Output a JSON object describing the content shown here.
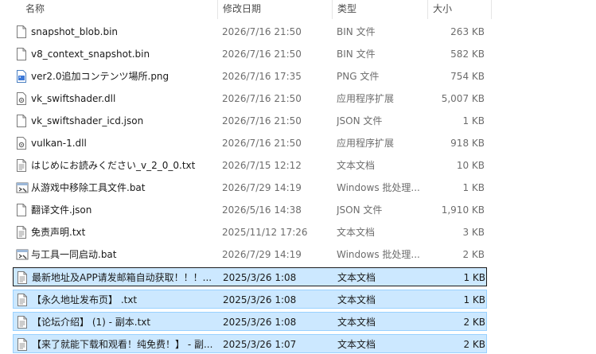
{
  "columns": {
    "name": "名称",
    "date": "修改日期",
    "type": "类型",
    "size": "大小"
  },
  "files": [
    {
      "name": "snapshot_blob.bin",
      "date": "2026/7/16 21:50",
      "type": "BIN 文件",
      "size": "263 KB",
      "icon": "blank-file-icon",
      "selected": false
    },
    {
      "name": "v8_context_snapshot.bin",
      "date": "2026/7/16 21:50",
      "type": "BIN 文件",
      "size": "582 KB",
      "icon": "blank-file-icon",
      "selected": false
    },
    {
      "name": "ver2.0追加コンテンツ場所.png",
      "date": "2026/7/16 17:35",
      "type": "PNG 文件",
      "size": "754 KB",
      "icon": "image-file-icon",
      "selected": false
    },
    {
      "name": "vk_swiftshader.dll",
      "date": "2026/7/16 21:50",
      "type": "应用程序扩展",
      "size": "5,007 KB",
      "icon": "dll-file-icon",
      "selected": false
    },
    {
      "name": "vk_swiftshader_icd.json",
      "date": "2026/7/16 21:50",
      "type": "JSON 文件",
      "size": "1 KB",
      "icon": "blank-file-icon",
      "selected": false
    },
    {
      "name": "vulkan-1.dll",
      "date": "2026/7/16 21:50",
      "type": "应用程序扩展",
      "size": "918 KB",
      "icon": "dll-file-icon",
      "selected": false
    },
    {
      "name": "はじめにお読みください_v_2_0_0.txt",
      "date": "2026/7/15 12:12",
      "type": "文本文档",
      "size": "10 KB",
      "icon": "text-file-icon",
      "selected": false
    },
    {
      "name": "从游戏中移除工具文件.bat",
      "date": "2026/7/29 14:19",
      "type": "Windows 批处理...",
      "size": "1 KB",
      "icon": "batch-file-icon",
      "selected": false
    },
    {
      "name": "翻译文件.json",
      "date": "2026/5/16 14:38",
      "type": "JSON 文件",
      "size": "1,910 KB",
      "icon": "blank-file-icon",
      "selected": false
    },
    {
      "name": "免责声明.txt",
      "date": "2025/11/12 17:26",
      "type": "文本文档",
      "size": "3 KB",
      "icon": "text-file-icon",
      "selected": false
    },
    {
      "name": "与工具一同启动.bat",
      "date": "2026/7/29 14:19",
      "type": "Windows 批处理...",
      "size": "2 KB",
      "icon": "batch-file-icon",
      "selected": false
    },
    {
      "name": "最新地址及APP请发邮箱自动获取！！！...",
      "date": "2025/3/26 1:08",
      "type": "文本文档",
      "size": "1 KB",
      "icon": "text-file-icon",
      "selected": true,
      "focus": true
    },
    {
      "name": "【永久地址发布页】 .txt",
      "date": "2025/3/26 1:08",
      "type": "文本文档",
      "size": "1 KB",
      "icon": "text-file-icon",
      "selected": true
    },
    {
      "name": "【论坛介绍】 (1) - 副本.txt",
      "date": "2025/3/26 1:08",
      "type": "文本文档",
      "size": "2 KB",
      "icon": "text-file-icon",
      "selected": true
    },
    {
      "name": "【来了就能下载和观看！纯免费！】 - 副...",
      "date": "2025/3/26 1:07",
      "type": "文本文档",
      "size": "2 KB",
      "icon": "text-file-icon",
      "selected": true
    }
  ]
}
